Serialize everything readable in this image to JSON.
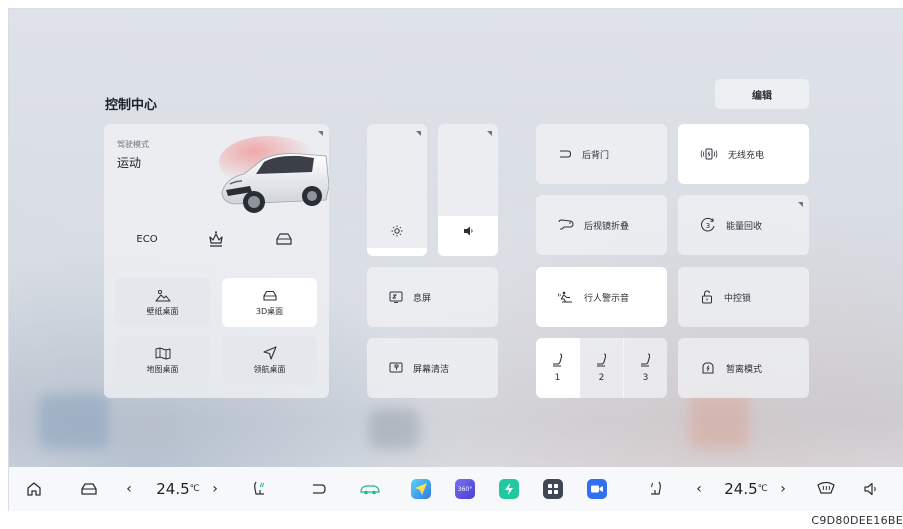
{
  "header": {
    "title": "控制中心",
    "edit_label": "编辑"
  },
  "drive_mode": {
    "label": "驾驶模式",
    "value": "运动",
    "modes": {
      "eco": "ECO"
    },
    "desktops": {
      "wallpaper": "壁纸桌面",
      "3d": "3D桌面",
      "map": "地图桌面",
      "nav": "领航桌面"
    }
  },
  "sliders": {
    "brightness_level": 0.06,
    "volume_level": 0.3
  },
  "controls": {
    "screen_off": "息屏",
    "screen_clean": "屏幕清洁",
    "tailgate": "后背门",
    "wireless_charging": "无线充电",
    "mirror_fold": "后视镜折叠",
    "energy_recovery": "能量回收",
    "energy_level": "3",
    "pedestrian_alert": "行人警示音",
    "center_lock": "中控锁",
    "away_mode": "暂离模式",
    "seat_memory": [
      "1",
      "2",
      "3"
    ]
  },
  "dock": {
    "left_temp": "24.5",
    "right_temp": "24.5",
    "temp_unit": "℃",
    "prev": "‹",
    "next": "›",
    "app_360_label": "360°"
  },
  "serial": "C9D80DEE16BE",
  "colors": {
    "accent_green": "#20b98a",
    "white_card": "#ffffff"
  }
}
